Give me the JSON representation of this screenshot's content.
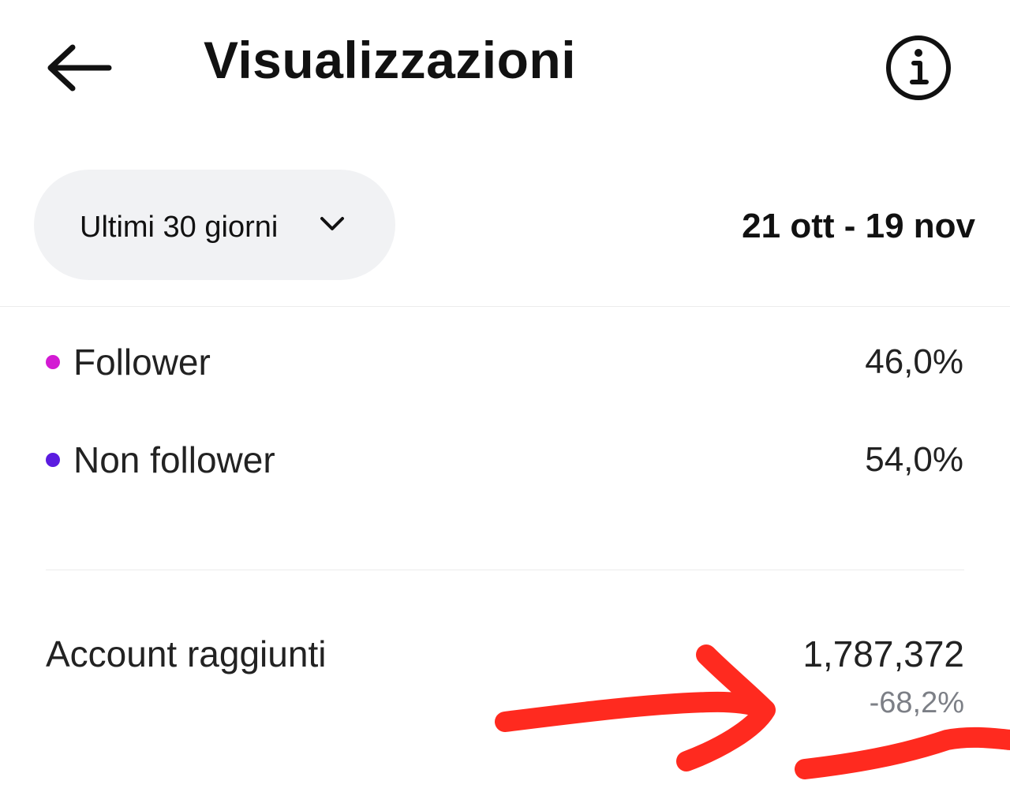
{
  "header": {
    "back_icon": "arrow-left-icon",
    "title": "Visualizzazioni",
    "info_icon": "info-circle-icon"
  },
  "filter": {
    "range_label": "Ultimi 30 giorni",
    "dropdown_icon": "chevron-down-icon",
    "date_range": "21 ott - 19 nov"
  },
  "breakdown": {
    "items": [
      {
        "label": "Follower",
        "value": "46,0%",
        "color": "#d31ad3"
      },
      {
        "label": "Non follower",
        "value": "54,0%",
        "color": "#5b1ce0"
      }
    ]
  },
  "metric": {
    "label": "Account raggiunti",
    "value": "1,787,372",
    "change": "-68,2%"
  },
  "annotation": {
    "color": "#ff2a1f",
    "shapes": [
      "hand-drawn-arrow",
      "hand-drawn-underline"
    ]
  }
}
